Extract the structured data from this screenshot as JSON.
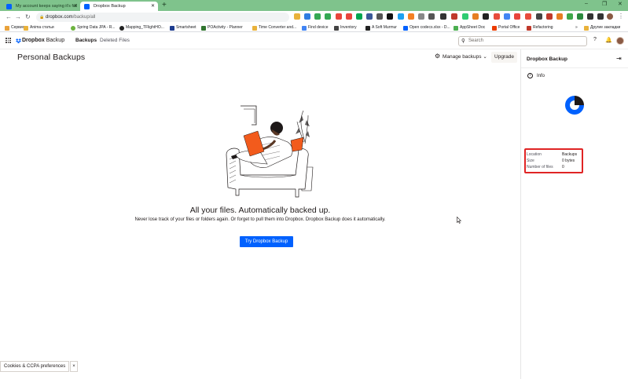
{
  "browser": {
    "tabs": [
      {
        "label": "My account keeps saying it's full",
        "active": false
      },
      {
        "label": "Dropbox Backup",
        "active": true
      }
    ],
    "new_tab": "+",
    "window_controls": [
      "–",
      "❐",
      "✕"
    ],
    "url_domain": "dropbox.com",
    "url_path": "/backup/all",
    "bookmarks": [
      "Сервисы",
      "Anima статьи",
      "Spring Data JPA - R...",
      "Mapping_TFlightHO...",
      "Smartsheet",
      "POActivity - Planner",
      "Time Converter and...",
      "Find device",
      "Inventory",
      "A Soft Murmur",
      "Open codecs.xlsx - D...",
      "AppSheet Doc",
      "Portal Office",
      "Refactoring"
    ],
    "bookmarks_overflow": "»",
    "other_bookmarks": "Другие закладки"
  },
  "header": {
    "brand": "Dropbox",
    "product": "Backup",
    "nav": [
      {
        "label": "Backups",
        "active": true
      },
      {
        "label": "Deleted Files",
        "active": false
      }
    ],
    "search_placeholder": "Search",
    "help_icon": "question-icon",
    "bell_icon": "bell-icon"
  },
  "main": {
    "title": "Personal Backups",
    "manage_label": "Manage backups",
    "upgrade_label": "Upgrade",
    "headline": "All your files. Automatically backed up.",
    "subline": "Never lose track of your files or folders again. Or forget to pull them into Dropbox. Dropbox Backup does it automatically.",
    "cta_label": "Try Dropbox Backup"
  },
  "sidepanel": {
    "title": "Dropbox Backup",
    "info_label": "Info",
    "details": [
      {
        "key": "Location",
        "value": "Backups"
      },
      {
        "key": "Size",
        "value": "0 bytes"
      },
      {
        "key": "Number of files",
        "value": "0"
      }
    ]
  },
  "footer": {
    "cookies_label": "Cookies & CCPA preferences",
    "cookies_close": "×"
  },
  "colors": {
    "brand_blue": "#0061fe",
    "tabstrip_green": "#7fc38c",
    "highlight_red": "#e02424",
    "illustration_orange": "#f25b1c"
  }
}
